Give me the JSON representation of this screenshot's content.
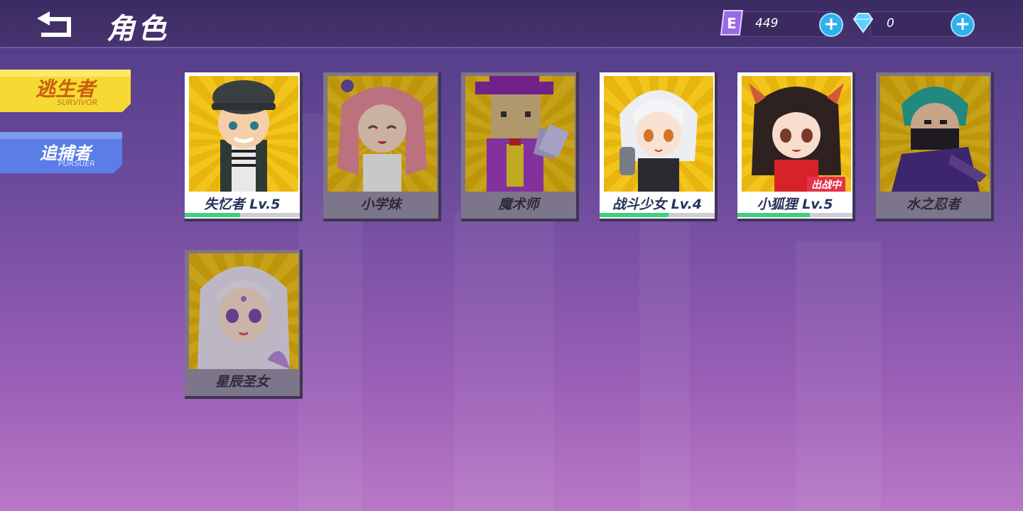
{
  "header": {
    "title": "角色",
    "energy": {
      "icon": "energy-e-icon",
      "value": "449"
    },
    "diamonds": {
      "icon": "diamond-icon",
      "value": "0"
    }
  },
  "tabs": [
    {
      "label": "逃生者",
      "sub": "SURVIVOR",
      "active": true
    },
    {
      "label": "追捕者",
      "sub": "PURSUER",
      "active": false
    }
  ],
  "characters": [
    {
      "name": "失忆者 Lv.5",
      "owned": true,
      "progress": 0.48
    },
    {
      "name": "小学妹",
      "owned": false
    },
    {
      "name": "魔术师",
      "owned": false
    },
    {
      "name": "战斗少女 Lv.4",
      "owned": true,
      "progress": 0.6
    },
    {
      "name": "小狐狸 Lv.5",
      "owned": true,
      "progress": 0.63,
      "badge": "出战中"
    },
    {
      "name": "水之忍者",
      "owned": false
    },
    {
      "name": "星辰圣女",
      "owned": false
    }
  ],
  "colors": {
    "accent_yellow": "#f2c51d",
    "progress_green": "#3ecf7c",
    "badge_red": "#e7304b"
  }
}
